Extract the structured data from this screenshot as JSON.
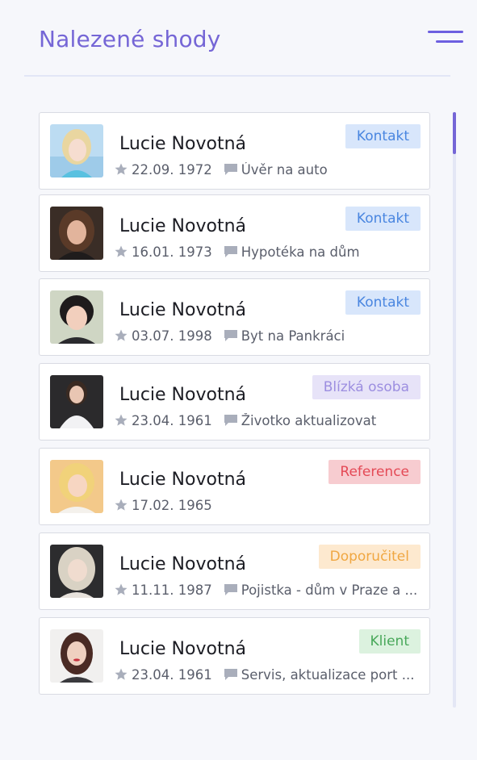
{
  "header": {
    "title": "Nalezené shody"
  },
  "badge_styles": {
    "contact": {
      "bg": "#d8e6fb",
      "fg": "#4a86e0"
    },
    "close_person": {
      "bg": "#e7e3f8",
      "fg": "#9c8ee0"
    },
    "reference": {
      "bg": "#f7ccd0",
      "fg": "#e44a56"
    },
    "recommender": {
      "bg": "#fde9cf",
      "fg": "#f0a742"
    },
    "client": {
      "bg": "#dcf2df",
      "fg": "#48a85a"
    }
  },
  "results": [
    {
      "name": "Lucie Novotná",
      "date": "22.09. 1972",
      "note": "Úvěr na auto",
      "badge": "Kontakt",
      "badge_style": "contact",
      "avatar": "avatar-blonde-icon"
    },
    {
      "name": "Lucie Novotná",
      "date": "16.01. 1973",
      "note": "Hypotéka na dům",
      "badge": "Kontakt",
      "badge_style": "contact",
      "avatar": "avatar-brunette-icon"
    },
    {
      "name": "Lucie Novotná",
      "date": "03.07. 1998",
      "note": "Byt na Pankráci",
      "badge": "Kontakt",
      "badge_style": "contact",
      "avatar": "avatar-dark-hair-icon"
    },
    {
      "name": "Lucie Novotná",
      "date": "23.04. 1961",
      "note": "Životko aktualizovat",
      "badge": "Blízká osoba",
      "badge_style": "close_person",
      "avatar": "avatar-business-icon"
    },
    {
      "name": "Lucie Novotná",
      "date": "17.02. 1965",
      "note": "",
      "badge": "Reference",
      "badge_style": "reference",
      "avatar": "avatar-sunny-blonde-icon"
    },
    {
      "name": "Lucie Novotná",
      "date": "11.11. 1987",
      "note": "Pojistka - dům v Praze a ...",
      "badge": "Doporučitel",
      "badge_style": "recommender",
      "avatar": "avatar-wavy-blonde-icon"
    },
    {
      "name": "Lucie Novotná",
      "date": "23.04. 1961",
      "note": "Servis, aktualizace port ...",
      "badge": "Klient",
      "badge_style": "client",
      "avatar": "avatar-red-lips-icon"
    }
  ]
}
